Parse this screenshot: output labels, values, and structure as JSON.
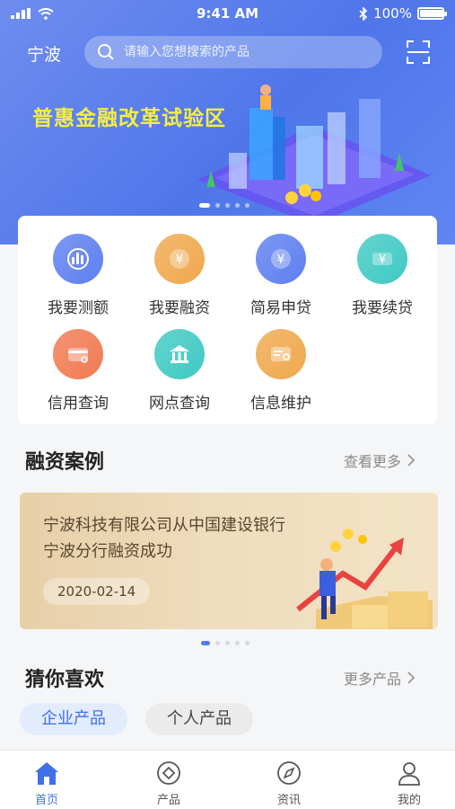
{
  "status_bar": {
    "time": "9:41 AM",
    "battery": "100%",
    "battery_level": 1.0
  },
  "header": {
    "city": "宁波",
    "search_placeholder": "请输入您想搜索的产品",
    "scan_icon": "scan-icon"
  },
  "banner": {
    "slogan": "普惠金融改革试验区",
    "slide_count": 5,
    "active_slide": 0
  },
  "quick_actions": [
    {
      "label": "我要测额",
      "icon": "chart-icon",
      "color": "#5d7ff0"
    },
    {
      "label": "我要融资",
      "icon": "yuan-coin-icon",
      "color": "#efa84d"
    },
    {
      "label": "简易申贷",
      "icon": "yuan-coin-icon",
      "color": "#5d7ff0"
    },
    {
      "label": "我要续贷",
      "icon": "yuan-card-icon",
      "color": "#3fc9c3"
    },
    {
      "label": "信用查询",
      "icon": "credit-card-icon",
      "color": "#f07a52"
    },
    {
      "label": "网点查询",
      "icon": "bank-icon",
      "color": "#3fc9c3"
    },
    {
      "label": "信息维护",
      "icon": "info-card-icon",
      "color": "#efa84d"
    }
  ],
  "financing_cases": {
    "title": "融资案例",
    "more_label": "查看更多",
    "card": {
      "text_line1": "宁波科技有限公司从中国建设银行",
      "text_line2": "宁波分行融资成功",
      "date": "2020-02-14"
    },
    "slide_count": 5,
    "active_slide": 0
  },
  "recommend": {
    "title": "猜你喜欢",
    "more_label": "更多产品",
    "tabs": [
      {
        "label": "企业产品",
        "active": true
      },
      {
        "label": "个人产品",
        "active": false
      }
    ]
  },
  "tabbar": [
    {
      "label": "首页",
      "icon": "home-icon",
      "active": true
    },
    {
      "label": "产品",
      "icon": "product-icon",
      "active": false
    },
    {
      "label": "资讯",
      "icon": "compass-icon",
      "active": false
    },
    {
      "label": "我的",
      "icon": "user-icon",
      "active": false
    }
  ],
  "colors": {
    "accent": "#3f6fe9",
    "slogan": "#f4ee43",
    "hero": "#5b7ff0"
  }
}
